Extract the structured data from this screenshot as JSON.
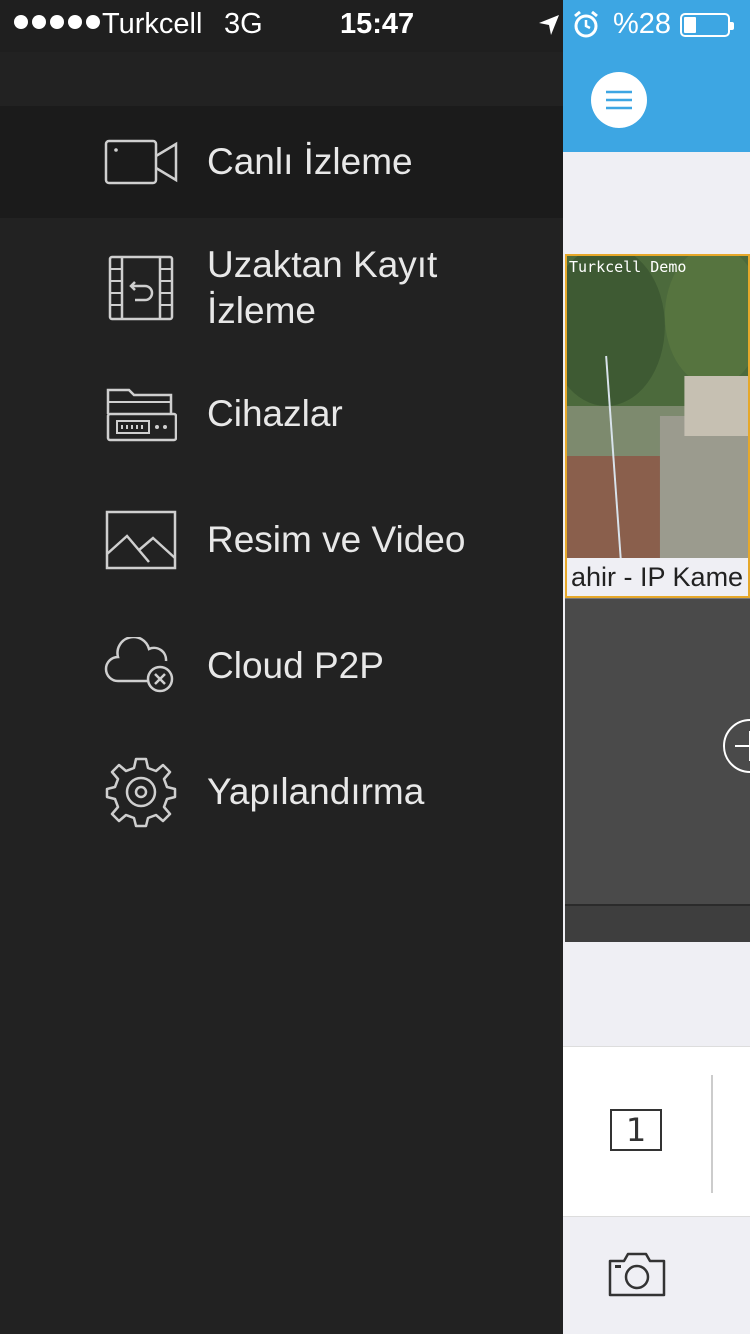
{
  "status_bar": {
    "carrier": "Turkcell",
    "network": "3G",
    "time": "15:47",
    "battery": "%28",
    "battery_level": 0.28
  },
  "menu": {
    "items": [
      {
        "label": "Canlı İzleme",
        "icon": "video-camera-icon",
        "active": true
      },
      {
        "label": "Uzaktan Kayıt\nİzleme",
        "icon": "film-replay-icon",
        "active": false
      },
      {
        "label": "Cihazlar",
        "icon": "dvr-folder-icon",
        "active": false
      },
      {
        "label": "Resim ve Video",
        "icon": "image-icon",
        "active": false
      },
      {
        "label": "Cloud P2P",
        "icon": "cloud-disconnected-icon",
        "active": false
      },
      {
        "label": "Yapılandırma",
        "icon": "gear-icon",
        "active": false
      }
    ]
  },
  "main": {
    "camera": {
      "overlay": "Turkcell Demo",
      "caption": "ahir - IP Kame"
    },
    "layout_button": "1"
  },
  "colors": {
    "menu_bg": "#222222",
    "accent": "#3da6e3",
    "selected_border": "#e6a82a"
  }
}
